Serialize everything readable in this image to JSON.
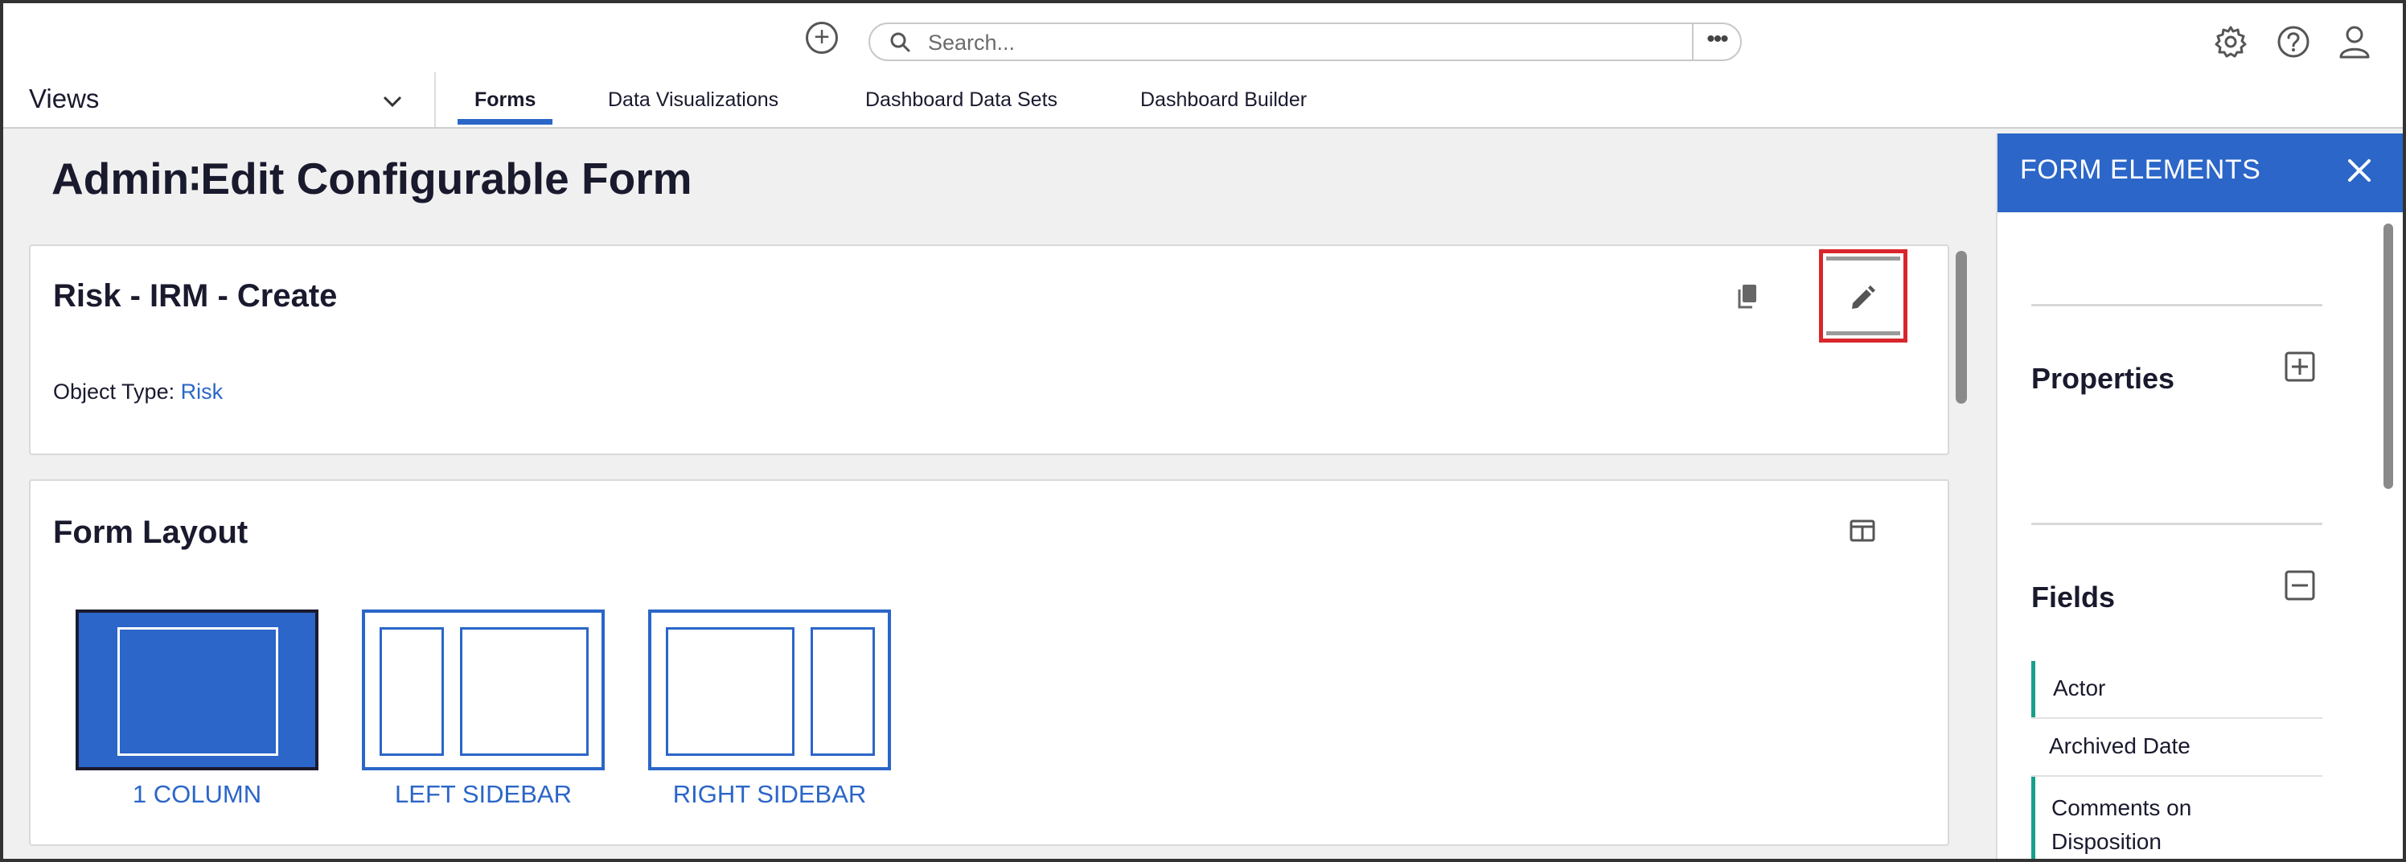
{
  "header": {
    "search_placeholder": "Search...",
    "search_more_label": "•••"
  },
  "nav": {
    "views_label": "Views",
    "tabs": [
      {
        "label": "Forms",
        "active": true
      },
      {
        "label": "Data Visualizations"
      },
      {
        "label": "Dashboard Data Sets"
      },
      {
        "label": "Dashboard Builder"
      }
    ]
  },
  "page": {
    "title": "Admin∶Edit Configurable Form"
  },
  "form_card": {
    "title": "Risk - IRM - Create",
    "object_type_label": "Object Type:",
    "object_type_value": "Risk"
  },
  "layout_card": {
    "title": "Form Layout",
    "options": [
      {
        "label": "1 COLUMN",
        "selected": true
      },
      {
        "label": "LEFT SIDEBAR"
      },
      {
        "label": "RIGHT SIDEBAR"
      }
    ]
  },
  "panel": {
    "title": "FORM ELEMENTS",
    "properties_heading": "Properties",
    "fields_heading": "Fields",
    "fields": [
      {
        "label": "Actor"
      },
      {
        "label": "Archived Date"
      },
      {
        "label": "Comments on Disposition"
      }
    ]
  },
  "colors": {
    "brand_blue": "#2b66c8",
    "accent_teal": "#16a08b",
    "highlight_red": "#d9262c"
  }
}
